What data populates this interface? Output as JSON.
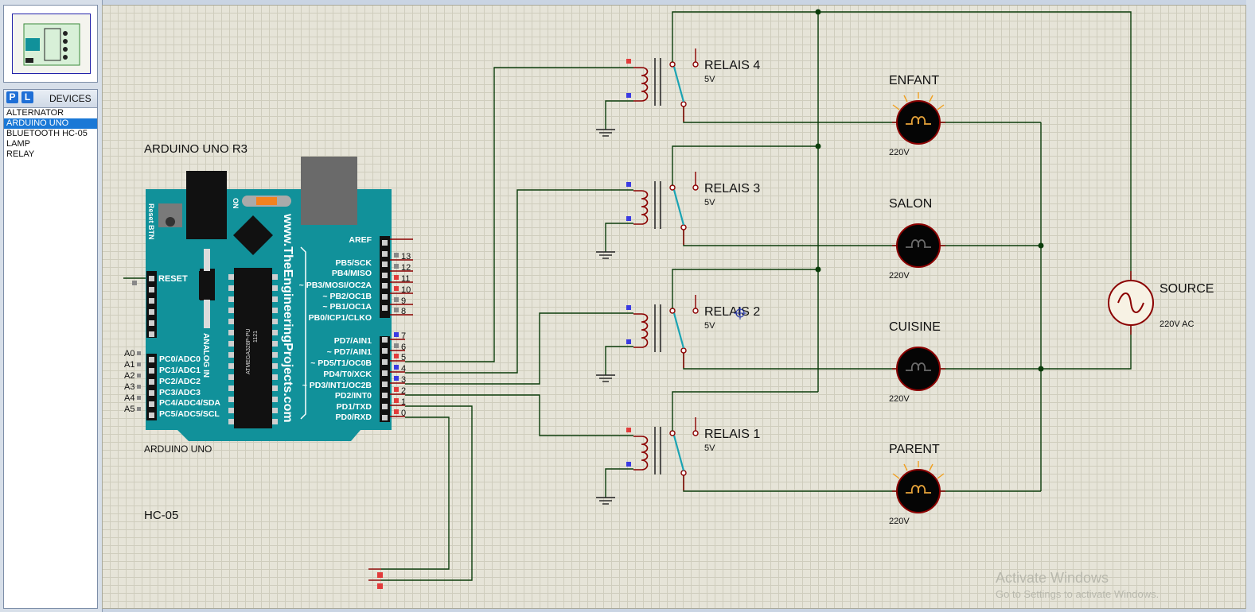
{
  "sidebar": {
    "p_label": "P",
    "l_label": "L",
    "devices_title": "DEVICES",
    "devices": [
      "ALTERNATOR",
      "ARDUINO UNO",
      "BLUETOOTH HC-05",
      "LAMP",
      "RELAY"
    ],
    "selected_device": "ARDUINO UNO"
  },
  "schematic": {
    "arduino": {
      "title": "ARDUINO UNO R3",
      "part_label": "ARDUINO UNO",
      "website": "www.TheEngineeringProjects.com",
      "reset_btn": "Reset BTN",
      "on_label": "ON",
      "reset_pin": "RESET",
      "analog_in": "ANALOG IN",
      "chip_text": "ATMEGA328P-PU",
      "chip_code": "1121",
      "digital_pins_top": [
        "AREF",
        "PB5/SCK",
        "PB4/MISO",
        "~ PB3/MOSI/OC2A",
        "~ PB2/OC1B",
        "~ PB1/OC1A",
        "PB0/ICP1/CLKO"
      ],
      "digital_nums_top": [
        "13",
        "12",
        "11",
        "10",
        "9",
        "8"
      ],
      "digital_pins_bottom": [
        "PD7/AIN1",
        "~ PD7/AIN1",
        "~ PD5/T1/OC0B",
        "PD4/T0/XCK",
        "~ PD3/INT1/OC2B",
        "PD2/INT0",
        "PD1/TXD",
        "PD0/RXD"
      ],
      "digital_nums_bottom": [
        "7",
        "6",
        "5",
        "4",
        "3",
        "2",
        "1",
        "0"
      ],
      "analog_labels": [
        "A0",
        "A1",
        "A2",
        "A3",
        "A4",
        "A5"
      ],
      "analog_pins": [
        "PC0/ADC0",
        "PC1/ADC1",
        "PC2/ADC2",
        "PC3/ADC3",
        "PC4/ADC4/SDA",
        "PC5/ADC5/SCL"
      ]
    },
    "hc05": {
      "label": "HC-05"
    },
    "relays": [
      {
        "name": "RELAIS 4",
        "voltage": "5V"
      },
      {
        "name": "RELAIS 3",
        "voltage": "5V"
      },
      {
        "name": "RELAIS 2",
        "voltage": "5V"
      },
      {
        "name": "RELAIS 1",
        "voltage": "5V"
      }
    ],
    "lamps": [
      {
        "name": "ENFANT",
        "voltage": "220V",
        "lit": true
      },
      {
        "name": "SALON",
        "voltage": "220V",
        "lit": false
      },
      {
        "name": "CUISINE",
        "voltage": "220V",
        "lit": false
      },
      {
        "name": "PARENT",
        "voltage": "220V",
        "lit": true
      }
    ],
    "source": {
      "name": "SOURCE",
      "voltage": "220V AC"
    }
  },
  "watermark": {
    "title": "Activate Windows",
    "subtitle": "Go to Settings to activate Windows."
  },
  "colors": {
    "wire": "#0b3d0b",
    "component": "#8b0000",
    "board": "#11919a",
    "pin_red": "#e23b3b",
    "pin_blue": "#3b3be2",
    "switch": "#1aa3b3"
  }
}
